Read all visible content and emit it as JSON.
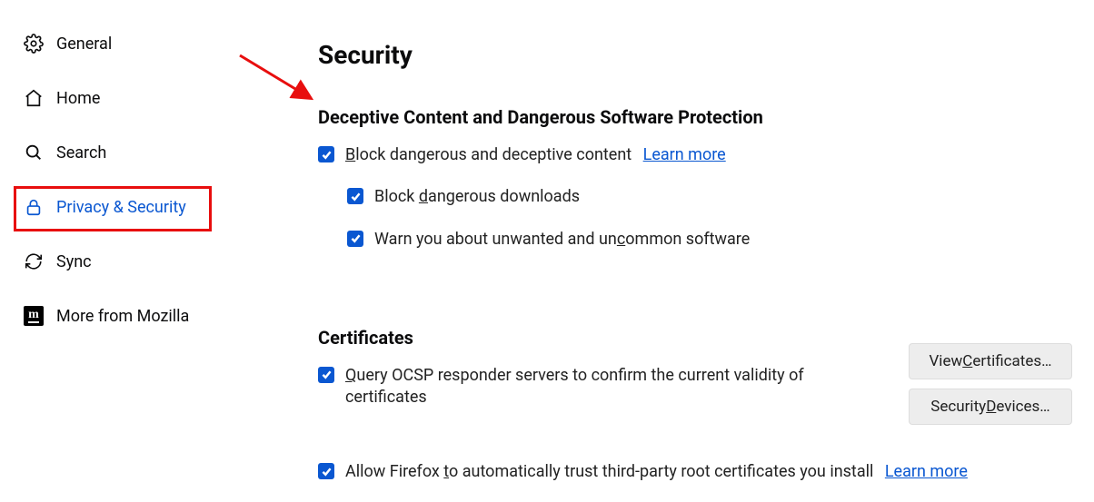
{
  "sidebar": {
    "items": [
      {
        "label": "General",
        "icon": "gear"
      },
      {
        "label": "Home",
        "icon": "home"
      },
      {
        "label": "Search",
        "icon": "search"
      },
      {
        "label": "Privacy & Security",
        "icon": "lock",
        "active": true
      },
      {
        "label": "Sync",
        "icon": "sync"
      },
      {
        "label": "More from Mozilla",
        "icon": "mozilla"
      }
    ]
  },
  "main": {
    "section_title": "Security",
    "deceptive": {
      "heading": "Deceptive Content and Dangerous Software Protection",
      "block_label_pre": "B",
      "block_label_rest": "lock dangerous and deceptive content",
      "block_learn_more": "Learn more",
      "downloads_label_pre": "Block ",
      "downloads_label_u": "d",
      "downloads_label_rest": "angerous downloads",
      "warn_label_pre": "Warn you about unwanted and un",
      "warn_label_u": "c",
      "warn_label_rest": "ommon software"
    },
    "certificates": {
      "heading": "Certificates",
      "ocsp_label_pre": "Q",
      "ocsp_label_rest": "uery OCSP responder servers to confirm the current validity of certificates",
      "auto_trust_label_pre": "Allow Firefox ",
      "auto_trust_label_u": "t",
      "auto_trust_label_rest": "o automatically trust third-party root certificates you install",
      "auto_trust_learn_more": "Learn more",
      "view_button_pre": "View ",
      "view_button_u": "C",
      "view_button_rest": "ertificates…",
      "devices_button_pre": "Security ",
      "devices_button_u": "D",
      "devices_button_rest": "evices…"
    }
  }
}
